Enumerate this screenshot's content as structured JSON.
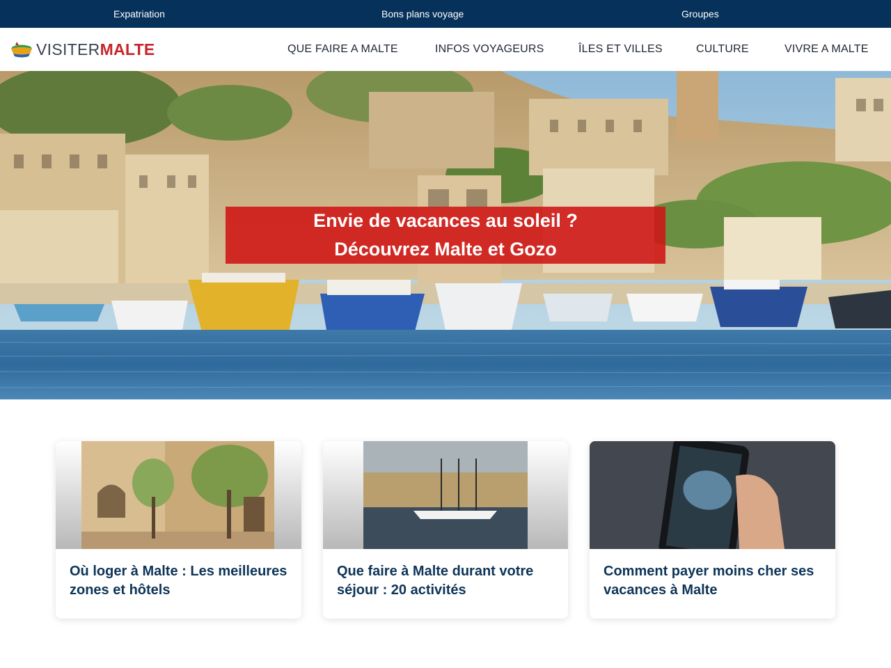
{
  "topbar": {
    "links": [
      "Expatriation",
      "Bons plans voyage",
      "Groupes"
    ]
  },
  "header": {
    "logo_part1": "VISITER",
    "logo_part2": "MALTE",
    "nav": [
      "QUE FAIRE A MALTE",
      "INFOS VOYAGEURS",
      "ÎLES ET VILLES",
      "CULTURE",
      "VIVRE A MALTE"
    ]
  },
  "hero": {
    "line1": "Envie de vacances au soleil ?",
    "line2": "Découvrez Malte et Gozo",
    "banner_color": "#cf1414"
  },
  "cards": [
    {
      "title": "Où loger à Malte : Les meilleures zones et hôtels"
    },
    {
      "title": "Que faire à Malte durant votre séjour : 20 activités"
    },
    {
      "title": "Comment payer moins cher ses vacances à Malte"
    }
  ],
  "colors": {
    "topbar": "#06315a",
    "card_title": "#0d3457",
    "logo_accent": "#c8252b"
  }
}
